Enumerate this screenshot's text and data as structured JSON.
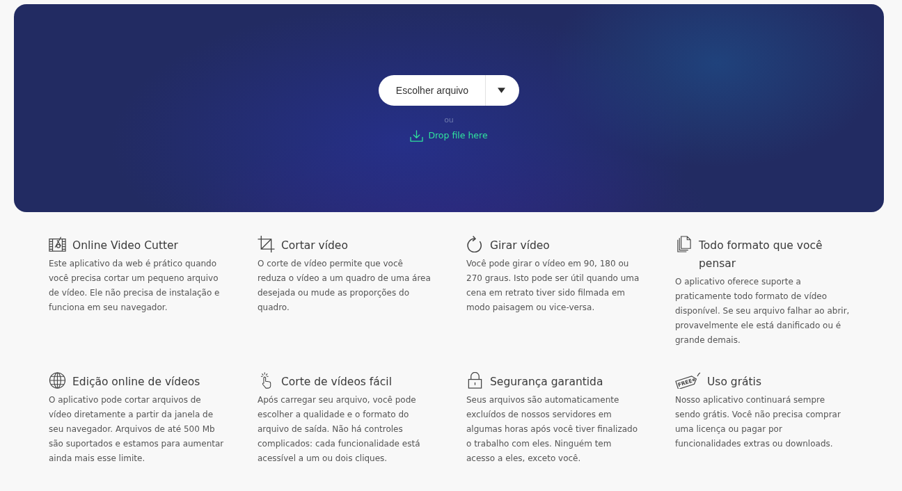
{
  "hero": {
    "upload_button": {
      "label": "Escolher arquivo"
    },
    "separator": "ou",
    "drop_zone": {
      "label": "Drop file here"
    }
  },
  "features": [
    {
      "kind": "film",
      "title": "Online Video Cutter",
      "text": "Este aplicativo da web é prático quando você precisa cortar um pequeno arquivo de vídeo. Ele não precisa de instalação e funciona em seu navegador."
    },
    {
      "kind": "crop",
      "title": "Cortar vídeo",
      "text": "O corte de vídeo permite que você reduza o vídeo a um quadro de uma área desejada ou mude as proporções do quadro."
    },
    {
      "kind": "rotate",
      "title": "Girar vídeo",
      "text": "Você pode girar o vídeo em 90, 180 ou 270 graus. Isto pode ser útil quando uma cena em retrato tiver sido filmada em modo paisagem ou vice-versa."
    },
    {
      "kind": "files",
      "title": "Todo formato que você pensar",
      "text": "O aplicativo oferece suporte a praticamente todo formato de vídeo disponível. Se seu arquivo falhar ao abrir, provavelmente ele está danificado ou é grande demais."
    },
    {
      "kind": "globe",
      "title": "Edição online de vídeos",
      "text": "O aplicativo pode cortar arquivos de vídeo diretamente a partir da janela de seu navegador. Arquivos de até 500 Mb são suportados e estamos para aumentar ainda mais esse limite."
    },
    {
      "kind": "hand",
      "title": "Corte de vídeos fácil",
      "text": "Após carregar seu arquivo, você pode escolher a qualidade e o formato do arquivo de saída. Não há controles complicados: cada funcionalidade está acessível a um ou dois cliques."
    },
    {
      "kind": "lock",
      "title": "Segurança garantida",
      "text": "Seus arquivos são automaticamente excluídos de nossos servidores em algumas horas após você tiver finalizado o trabalho com eles. Ninguém tem acesso a eles, exceto você."
    },
    {
      "kind": "tag",
      "icon_label": "FREE",
      "title": "Uso grátis",
      "text": "Nosso aplicativo continuará sempre sendo grátis. Você não precisa comprar uma licença ou pagar por funcionalidades extras ou downloads."
    }
  ]
}
